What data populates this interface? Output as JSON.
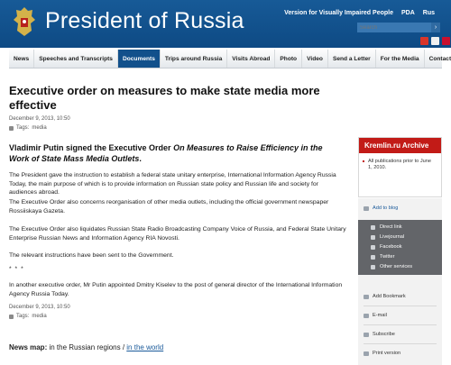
{
  "header": {
    "site_title": "President of Russia",
    "visually_impaired_link": "Version for Visually Impaired People",
    "pda_link": "PDA",
    "rus_link": "Rus",
    "search_placeholder": "Search",
    "search_button": "›",
    "brand_color": "#0e4a84"
  },
  "nav": {
    "items": [
      "News",
      "Speeches and Transcripts",
      "Documents",
      "Trips around Russia",
      "Visits Abroad",
      "Photo",
      "Video",
      "Send a Letter",
      "For the Media",
      "Contacts"
    ],
    "active": "Documents"
  },
  "article": {
    "title": "Executive order on measures to make state media more effective",
    "date": "December 9, 2013, 10:50",
    "tags_label": "Tags:",
    "tags_value": "media",
    "lead_prefix": "Vladimir Putin signed the Executive Order ",
    "lead_italic": "On Measures to Raise Efficiency in the Work of State Mass Media Outlets",
    "lead_suffix": ".",
    "paragraphs": [
      "The President gave the instruction to establish a federal state unitary enterprise, International Information Agency Russia Today, the main purpose of which is to provide information on Russian state policy and Russian life and society for audiences abroad.",
      "The Executive Order also concerns reorganisation of other media outlets, including the official government newspaper Rossiiskaya Gazeta.",
      "The Executive Order also liquidates Russian State Radio Broadcasting Company Voice of Russia, and Federal State Unitary Enterprise Russian News and Information Agency RIA Novosti.",
      "The relevant instructions have been sent to the Government.",
      "* * *",
      "In another executive order, Mr Putin appointed Dmitry Kiselev to the post of general director of the International Information Agency Russia Today."
    ],
    "date_bottom": "December 9, 2013, 10:50",
    "tags_label_bottom": "Tags:",
    "tags_value_bottom": "media",
    "news_map_label": "News map:",
    "news_map_regions": " in the Russian regions / ",
    "news_map_world": "in the world"
  },
  "sidebar": {
    "archive_title": "Kremlin.ru Archive",
    "archive_text": "All publications prior to June 1, 2010.",
    "archive_color": "#c21b17",
    "add_to_blog": "Add to blog",
    "share_items": [
      "Direct link",
      "Livejournal",
      "Facebook",
      "Twitter",
      "Other services"
    ],
    "add_bookmark": "Add Bookmark",
    "email": "E-mail",
    "subscribe": "Subscribe",
    "print_version": "Print version",
    "panel_color": "#636569"
  }
}
